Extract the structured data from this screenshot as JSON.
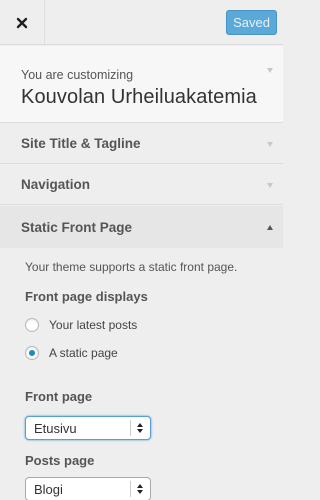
{
  "header": {
    "close_icon": "close-icon",
    "saved_label": "Saved",
    "saved_color": "#5aa9d8"
  },
  "info": {
    "customizing_label": "You are customizing",
    "site_name": "Kouvolan Urheiluakatemia"
  },
  "sections": [
    {
      "label": "Site Title & Tagline",
      "state": "collapsed"
    },
    {
      "label": "Navigation",
      "state": "collapsed"
    },
    {
      "label": "Static Front Page",
      "state": "expanded"
    }
  ],
  "static_front_page": {
    "description": "Your theme supports a static front page.",
    "displays_label": "Front page displays",
    "options": [
      {
        "label": "Your latest posts",
        "checked": false
      },
      {
        "label": "A static page",
        "checked": true
      }
    ],
    "front_page_label": "Front page",
    "front_page_value": "Etusivu",
    "posts_page_label": "Posts page",
    "posts_page_value": "Blogi",
    "accent_color": "#1e8cbe"
  }
}
